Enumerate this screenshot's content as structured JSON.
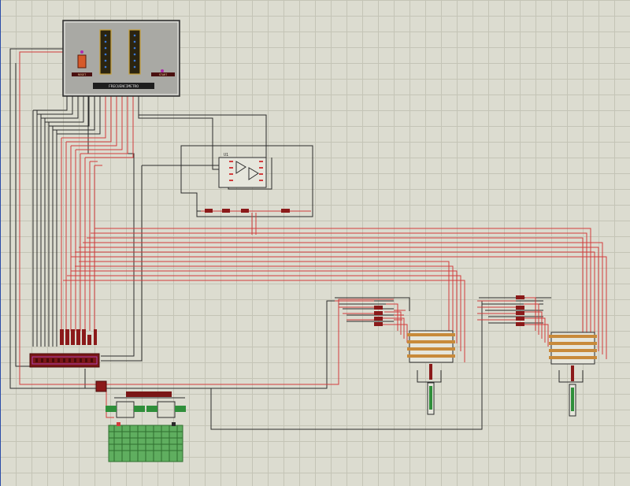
{
  "schematic": {
    "panel": {
      "label_left": "RESET",
      "label_right": "START",
      "display_caption": "FRECUENCIMETRO"
    },
    "opamp": {
      "label": "U1"
    },
    "colors": {
      "sheet_bg": "#dcdcd0",
      "grid_line": "#c4c4b6",
      "wire_red": "#d23c3c",
      "wire_dark": "#2b2b2b",
      "component_red": "#8b1a1a",
      "component_green": "#2f8f3a",
      "panel_gray": "#a9a9a4",
      "led_blue": "#3a78d8"
    }
  }
}
